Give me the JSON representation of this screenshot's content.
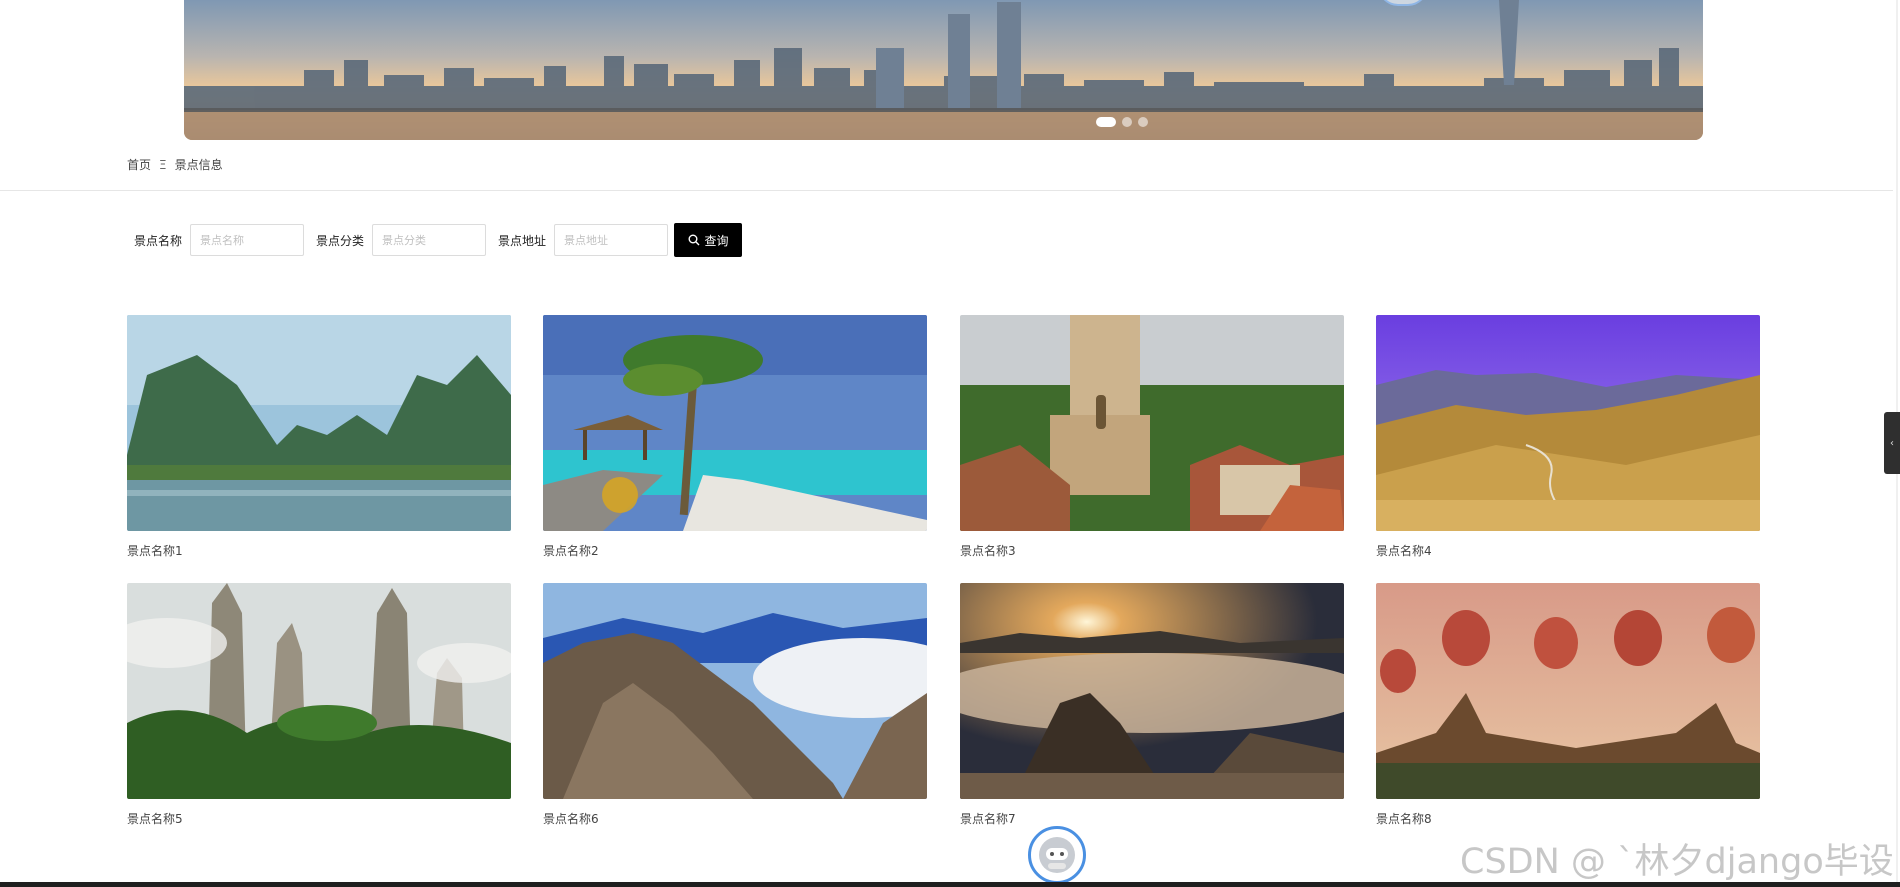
{
  "banner": {
    "slides": [
      "1",
      "2",
      "3"
    ],
    "active_slide": 1
  },
  "breadcrumb": {
    "home": "首页",
    "separator": "Ξ",
    "current": "景点信息"
  },
  "search": {
    "name_label": "景点名称",
    "name_placeholder": "景点名称",
    "category_label": "景点分类",
    "category_placeholder": "景点分类",
    "address_label": "景点地址",
    "address_placeholder": "景点地址",
    "button_label": "查询"
  },
  "spots": [
    {
      "name": "景点名称1",
      "scene": "karst-river"
    },
    {
      "name": "景点名称2",
      "scene": "tropical-beach"
    },
    {
      "name": "景点名称3",
      "scene": "old-town-church"
    },
    {
      "name": "景点名称4",
      "scene": "mountain-valley"
    },
    {
      "name": "景点名称5",
      "scene": "stone-pillars"
    },
    {
      "name": "景点名称6",
      "scene": "mountain-clouds"
    },
    {
      "name": "景点名称7",
      "scene": "sea-of-clouds"
    },
    {
      "name": "景点名称8",
      "scene": "hot-air-balloons"
    }
  ],
  "watermark": "CSDN @ `林夕django毕设",
  "colors": {
    "search_button": "#000000",
    "accent_blue": "#4a90e2"
  }
}
